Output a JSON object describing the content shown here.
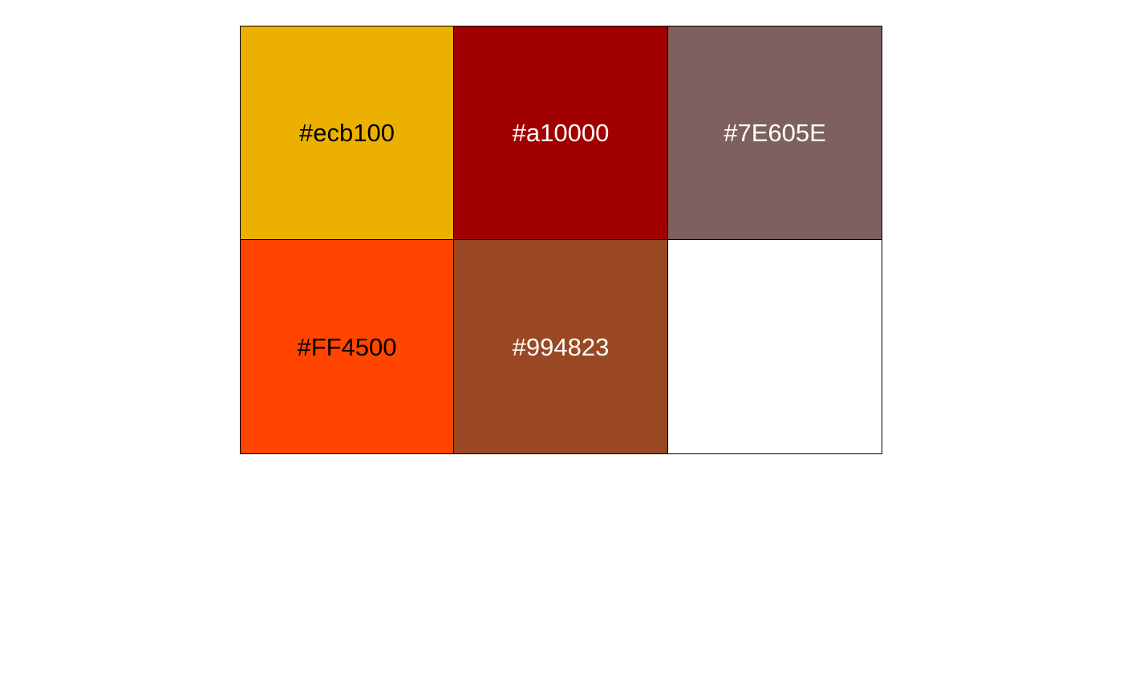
{
  "swatches": [
    {
      "label": "#ecb100",
      "color": "#ecb100",
      "text_color": "#000000"
    },
    {
      "label": "#a10000",
      "color": "#a10000",
      "text_color": "#ffffff"
    },
    {
      "label": "#7E605E",
      "color": "#7E605E",
      "text_color": "#ffffff"
    },
    {
      "label": "#FF4500",
      "color": "#FF4500",
      "text_color": "#000000"
    },
    {
      "label": "#994823",
      "color": "#994823",
      "text_color": "#ffffff"
    },
    {
      "label": "",
      "color": "#ffffff",
      "text_color": "#000000"
    }
  ]
}
